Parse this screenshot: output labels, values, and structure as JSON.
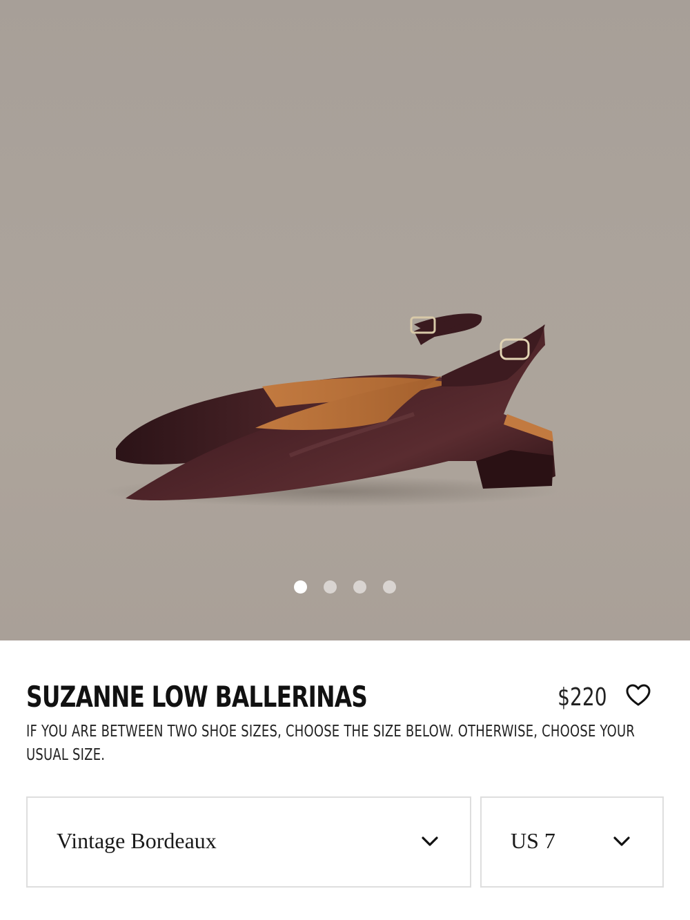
{
  "product": {
    "name": "SUZANNE LOW BALLERINAS",
    "price": "$220",
    "size_note": "IF YOU ARE BETWEEN TWO SHOE SIZES, CHOOSE THE SIZE BELOW. OTHERWISE, CHOOSE YOUR USUAL SIZE.",
    "image_alt": "Vintage Bordeaux leather slingback ballerina flats"
  },
  "gallery": {
    "slide_count": 4,
    "active_index": 0
  },
  "selectors": {
    "color_value": "Vintage Bordeaux",
    "size_value": "US 7"
  },
  "icons": {
    "wishlist": "heart-outline-icon",
    "dropdown": "chevron-down-icon"
  },
  "colors": {
    "shoe_leather": "#3a1a1f",
    "lining": "#b06a35",
    "backdrop": "#aba39b"
  }
}
